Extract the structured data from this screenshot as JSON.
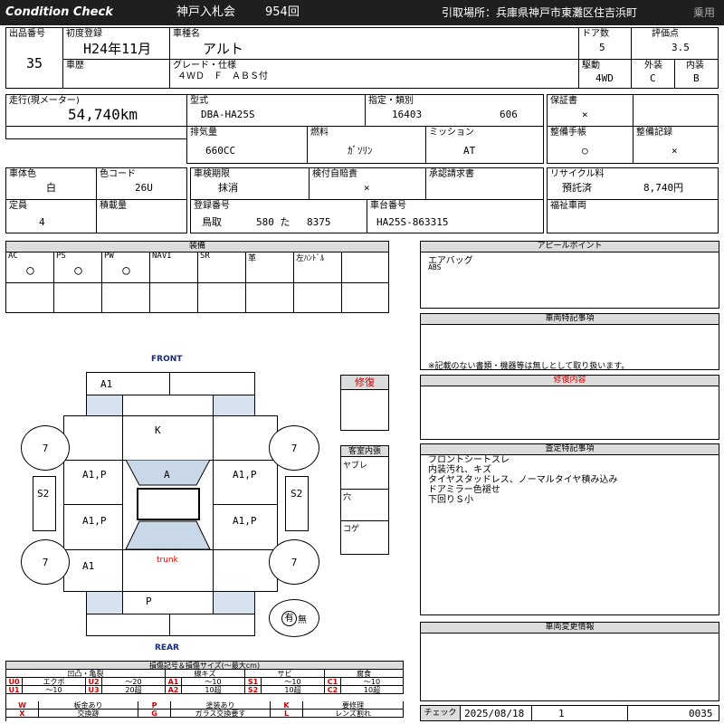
{
  "header": {
    "left": "Condition Check",
    "title": "神戸入札会",
    "session": "954回",
    "pickup": "引取場所：兵庫県神戸市東灘区住吉浜町",
    "category": "乗用"
  },
  "info": {
    "lot_label": "出品番号",
    "lot": "35",
    "reg_label": "初度登録",
    "reg": "H24年11月",
    "name_label": "車種名",
    "name": "アルト",
    "history_label": "車歴",
    "grade_label": "グレード・仕様",
    "grade": "４ＷＤ　Ｆ　ＡＢＳ付",
    "doors_label": "ドア数",
    "doors": "5",
    "score_label": "評価点",
    "score": "3.5",
    "drive_label": "駆動",
    "drive": "4WD",
    "ext_label": "外装",
    "ext": "C",
    "int_label": "内装",
    "int": "B",
    "mileage_label": "走行(現メーター)",
    "mileage": "54,740km",
    "model_label": "型式",
    "model": "DBA-HA25S",
    "desig_label": "指定・類別",
    "desig1": "16403",
    "desig2": "606",
    "warranty_label": "保証書",
    "warranty": "×",
    "disp_label": "排気量",
    "disp": "660CC",
    "fuel_label": "燃料",
    "fuel": "ｶﾞｿﾘﾝ",
    "mission_label": "ミッション",
    "mission": "AT",
    "mbook_label": "整備手帳",
    "mbook": "○",
    "mrec_label": "整備記録",
    "mrec": "×",
    "color_label": "車体色",
    "color": "白",
    "ccode_label": "色コード",
    "ccode": "26U",
    "inspect_label": "車検期限",
    "inspect": "抹消",
    "ins_label": "検付自賠責",
    "ins": "×",
    "claim_label": "承認請求書",
    "recycle_label": "リサイクル料",
    "recycle_status": "預託済",
    "recycle": "8,740円",
    "cap_label": "定員",
    "cap": "4",
    "load_label": "積載量",
    "plate_label": "登録番号",
    "plate_area": "鳥取",
    "plate_num": "580 た",
    "plate_no": "8375",
    "chassis_label": "車台番号",
    "chassis": "HA25S-863315",
    "welfare_label": "福祉車両"
  },
  "equipment": {
    "title": "装備",
    "items": [
      {
        "label": "AC",
        "val": "○"
      },
      {
        "label": "PS",
        "val": "○"
      },
      {
        "label": "PW",
        "val": "○"
      },
      {
        "label": "NAVI",
        "val": ""
      },
      {
        "label": "SR",
        "val": ""
      },
      {
        "label": "革",
        "val": ""
      },
      {
        "label": "左ﾊﾝﾄﾞﾙ",
        "val": ""
      }
    ]
  },
  "appeal": {
    "title": "アピールポイント",
    "line1": "エアバッグ",
    "line2": "ABS"
  },
  "special": {
    "title": "車両特記事項",
    "note": "※記載のない書類・機器等は無しとして取り扱います。"
  },
  "repair_content": {
    "title": "修復内容"
  },
  "repair": {
    "label": "修復"
  },
  "cabin": {
    "title": "客室内張",
    "rows": [
      "ヤブレ",
      "穴",
      "コゲ"
    ]
  },
  "inspector": {
    "title": "査定特記事項",
    "lines": [
      "フロントシートスレ",
      "内装汚れ、キズ",
      "タイヤスタッドレス、ノーマルタイヤ積み込み",
      "ドアミラー色褪せ",
      "下回りＳ小"
    ]
  },
  "changes": {
    "title": "車両変更情報"
  },
  "check": {
    "label": "チェック",
    "date": "2025/08/18",
    "num": "1",
    "code": "0035"
  },
  "diagram": {
    "front": "FRONT",
    "rear": "REAR",
    "trunk": "trunk",
    "codes": {
      "front_bumper": "A1",
      "hood": "K",
      "fl_door": "A1,P",
      "roof": "A",
      "fr_door": "A1,P",
      "rl_door": "A1,P",
      "rr_door": "A1,P",
      "rear_fender": "A1",
      "rear": "P",
      "tire_fl": "7",
      "tire_fr": "7",
      "tire_rl": "7",
      "tire_rr": "7",
      "side_l": "S2",
      "side_r": "S2"
    },
    "spare_mark": "有",
    "spare_none": "無"
  },
  "legend": {
    "title": "損傷記号＆損傷サイズ(〜最大cm)",
    "groups": [
      "凹凸・亀裂",
      "線キズ",
      "サビ",
      "腐食"
    ],
    "row1": [
      {
        "c": "U0",
        "t": "エクボ"
      },
      {
        "c": "U2",
        "t": "〜20"
      },
      {
        "c": "A1",
        "t": "〜10"
      },
      {
        "c": "S1",
        "t": "〜10"
      },
      {
        "c": "C1",
        "t": "〜10"
      }
    ],
    "row2": [
      {
        "c": "U1",
        "t": "〜10"
      },
      {
        "c": "U3",
        "t": "20超"
      },
      {
        "c": "A2",
        "t": "10超"
      },
      {
        "c": "S2",
        "t": "10超"
      },
      {
        "c": "C2",
        "t": "10超"
      }
    ],
    "row3": [
      {
        "c": "W",
        "t": "板金あり"
      },
      {
        "c": "P",
        "t": "塗装あり"
      },
      {
        "c": "K",
        "t": "要修理"
      }
    ],
    "row4": [
      {
        "c": "X",
        "t": "交換跡"
      },
      {
        "c": "G",
        "t": "ガラス交換要す"
      },
      {
        "c": "L",
        "t": "レンズ割れ"
      }
    ]
  }
}
